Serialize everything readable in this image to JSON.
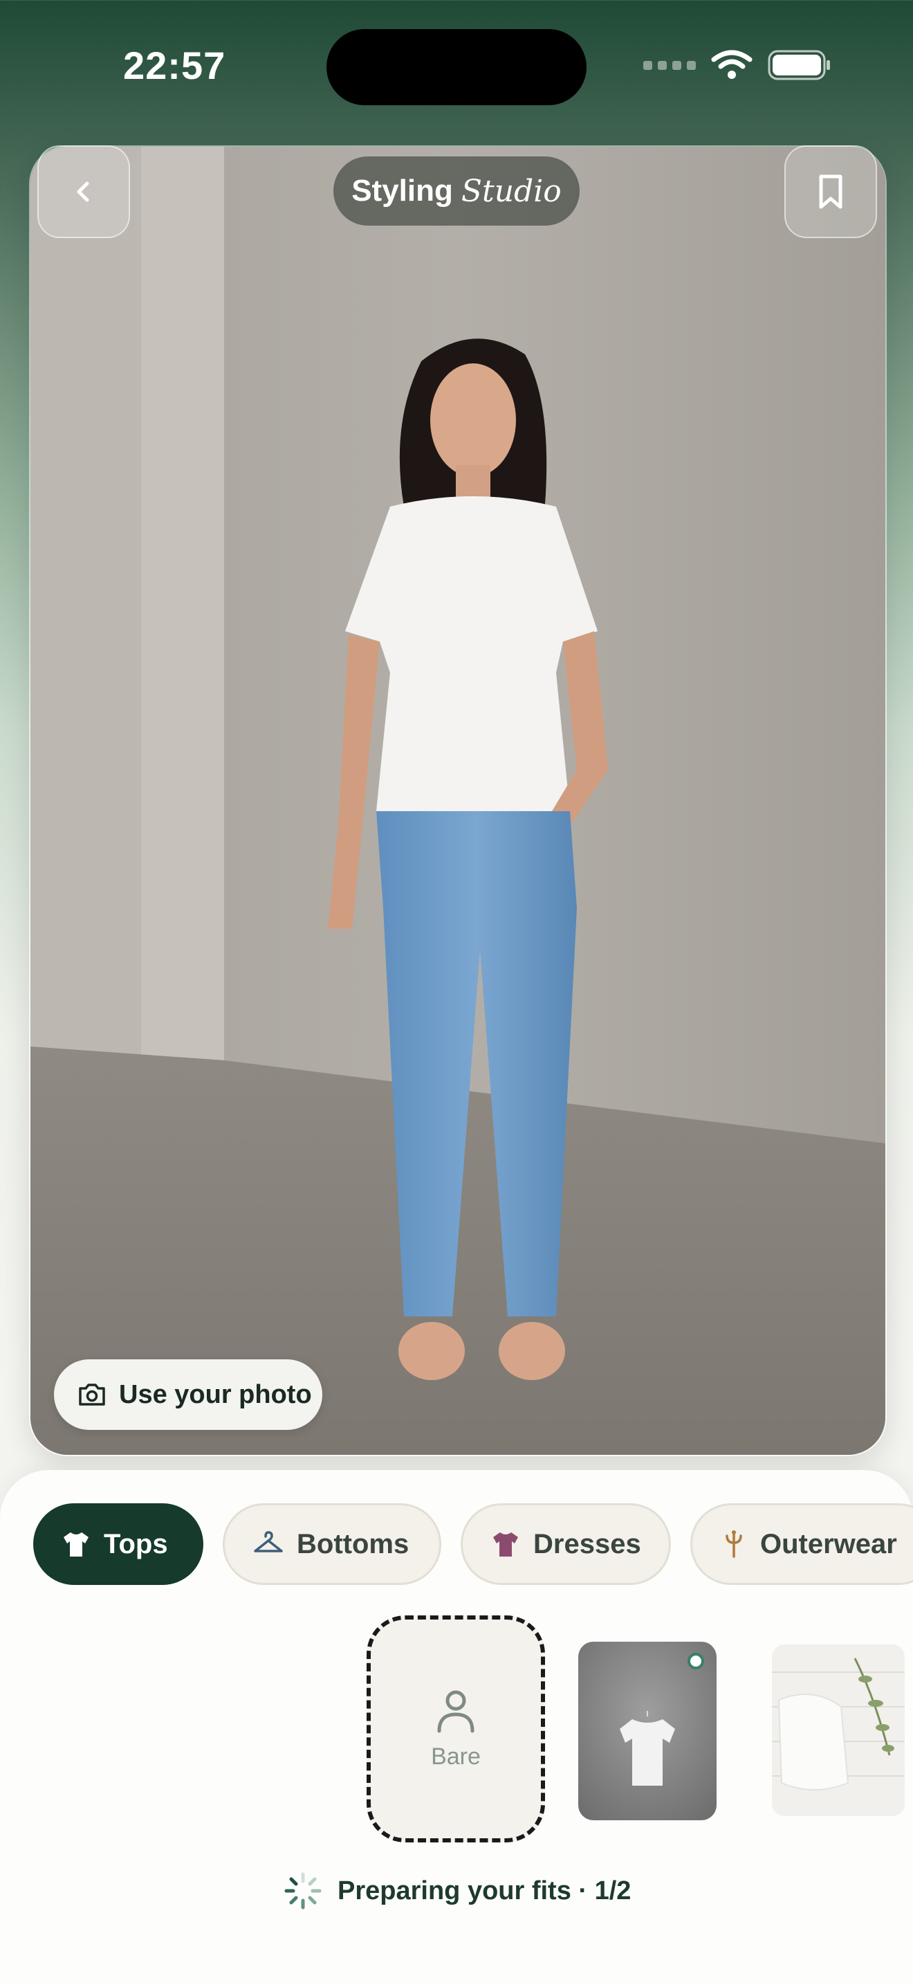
{
  "status_bar": {
    "time": "22:57"
  },
  "header": {
    "title_bold": "Styling",
    "title_italic": "Studio"
  },
  "photo": {
    "use_photo_label": "Use your photo"
  },
  "categories": [
    {
      "label": "Tops",
      "icon": "tshirt-icon",
      "active": true
    },
    {
      "label": "Bottoms",
      "icon": "hanger-icon",
      "active": false
    },
    {
      "label": "Dresses",
      "icon": "dress-icon",
      "active": false
    },
    {
      "label": "Outerwear",
      "icon": "coat-hook-icon",
      "active": false
    }
  ],
  "outfit_picker": {
    "bare_label": "Bare"
  },
  "progress": {
    "label": "Preparing your fits · 1/2"
  },
  "colors": {
    "accent": "#163a2c",
    "chip_bg": "#f3f1ea",
    "dresses_icon": "#8c4b6e",
    "outerwear_icon": "#b07a3a"
  }
}
